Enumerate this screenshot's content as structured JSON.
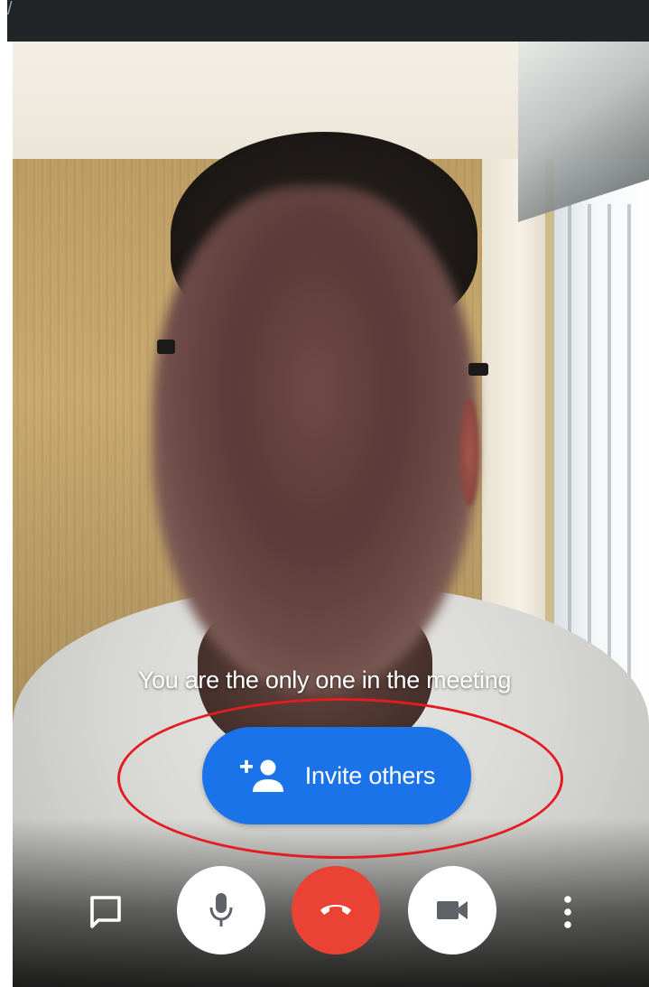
{
  "meeting": {
    "status_message": "You are the only one in the meeting",
    "invite_label": "Invite others"
  },
  "controls": {
    "items": [
      {
        "name": "chat",
        "icon": "chat-icon"
      },
      {
        "name": "microphone",
        "icon": "mic-icon"
      },
      {
        "name": "end-call",
        "icon": "phone-hangup-icon"
      },
      {
        "name": "camera",
        "icon": "videocam-icon"
      },
      {
        "name": "more-options",
        "icon": "more-vert-icon"
      }
    ]
  },
  "colors": {
    "accent": "#1a73e8",
    "end_call": "#ea4335",
    "annotation": "#e31b23",
    "top_bar": "#212528"
  },
  "annotation": {
    "shape": "ellipse",
    "target": "invite-button"
  }
}
